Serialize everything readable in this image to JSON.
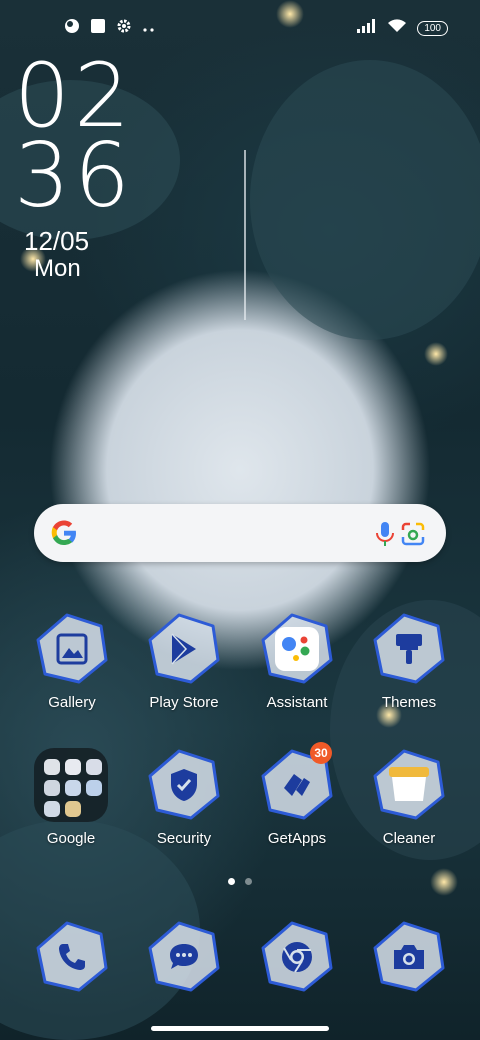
{
  "status_bar": {
    "icons_left": [
      "circle-app-icon",
      "square-app-icon",
      "settings-icon",
      "more-dots-icon"
    ],
    "icons_right": [
      "signal-icon",
      "wifi-icon"
    ],
    "battery": "100"
  },
  "clock": {
    "hours": "02",
    "minutes": "36",
    "date": "12/05",
    "weekday": "Mon"
  },
  "search_bar": {
    "icons": [
      "google-g-icon",
      "microphone-icon",
      "google-lens-icon"
    ]
  },
  "apps_row1": [
    {
      "label": "Gallery",
      "icon": "gallery-icon"
    },
    {
      "label": "Play Store",
      "icon": "play-store-icon"
    },
    {
      "label": "Assistant",
      "icon": "assistant-icon"
    },
    {
      "label": "Themes",
      "icon": "themes-icon"
    }
  ],
  "apps_row2": [
    {
      "label": "Google",
      "icon": "google-folder-icon"
    },
    {
      "label": "Security",
      "icon": "security-icon"
    },
    {
      "label": "GetApps",
      "icon": "getapps-icon",
      "badge": "30"
    },
    {
      "label": "Cleaner",
      "icon": "cleaner-icon"
    }
  ],
  "page_indicator": {
    "pages": 2,
    "current": 1
  },
  "dock": [
    {
      "icon": "phone-icon"
    },
    {
      "icon": "messages-icon"
    },
    {
      "icon": "chrome-icon"
    },
    {
      "icon": "camera-icon"
    }
  ],
  "colors": {
    "icon_border": "#2d5bd6",
    "icon_glyph": "#1d3c9e",
    "badge": "#f05a28"
  }
}
